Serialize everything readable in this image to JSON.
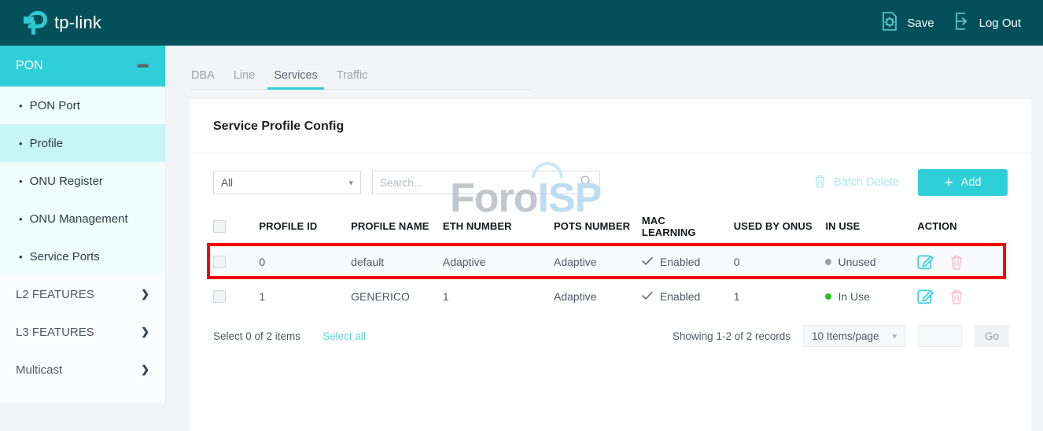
{
  "topbar": {
    "brand": "tp-link",
    "actions": [
      {
        "label": "Save",
        "icon": "save-document-gear-icon"
      },
      {
        "label": "Log Out",
        "icon": "logout-arrow-icon"
      }
    ]
  },
  "sidebar": {
    "active_group": {
      "label": "PON",
      "icon": "chevron-down-icon"
    },
    "sub_items": [
      {
        "label": "PON Port",
        "active": false
      },
      {
        "label": "Profile",
        "active": true
      },
      {
        "label": "ONU Register",
        "active": false
      },
      {
        "label": "ONU Management",
        "active": false
      },
      {
        "label": "Service Ports",
        "active": false
      }
    ],
    "groups": [
      {
        "label": "L2 FEATURES"
      },
      {
        "label": "L3 FEATURES"
      },
      {
        "label": "Multicast"
      }
    ]
  },
  "tabs": [
    {
      "label": "DBA",
      "active": false
    },
    {
      "label": "Line",
      "active": false
    },
    {
      "label": "Services",
      "active": true
    },
    {
      "label": "Traffic",
      "active": false
    }
  ],
  "card": {
    "title": "Service Profile Config"
  },
  "toolbar": {
    "filter_value": "All",
    "search_placeholder": "Search...",
    "search_value": "",
    "batch_delete_label": "Batch Delete",
    "add_label": "Add"
  },
  "table": {
    "columns": [
      "PROFILE ID",
      "PROFILE NAME",
      "ETH NUMBER",
      "POTS NUMBER",
      "MAC LEARNING",
      "USED BY ONUS",
      "IN USE",
      "ACTION"
    ],
    "mac_column_line1": "MAC",
    "mac_column_line2": "LEARNING",
    "rows": [
      {
        "profile_id": "0",
        "profile_name": "default",
        "eth_number": "Adaptive",
        "pots_number": "Adaptive",
        "mac_learning": "Enabled",
        "used_by_onus": "0",
        "in_use": "Unused",
        "in_use_color": "#9aa0a6",
        "highlighted": false
      },
      {
        "profile_id": "1",
        "profile_name": "GENERICO",
        "eth_number": "1",
        "pots_number": "Adaptive",
        "mac_learning": "Enabled",
        "used_by_onus": "1",
        "in_use": "In Use",
        "in_use_color": "#1fc41f",
        "highlighted": true
      }
    ]
  },
  "footer": {
    "select_count_label": "Select 0 of 2 items",
    "select_all_label": "Select all",
    "records_label": "Showing 1-2 of 2 records",
    "page_size": "10 Items/page",
    "page_input_value": "",
    "go_label": "Go"
  },
  "watermark": {
    "part1": "Foro",
    "part2": "ISP"
  },
  "colors": {
    "header_bg": "#04505a",
    "accent": "#2fcfd9",
    "highlight_border": "#f40000",
    "in_use_green": "#1fc41f",
    "unused_gray": "#9aa0a6"
  }
}
